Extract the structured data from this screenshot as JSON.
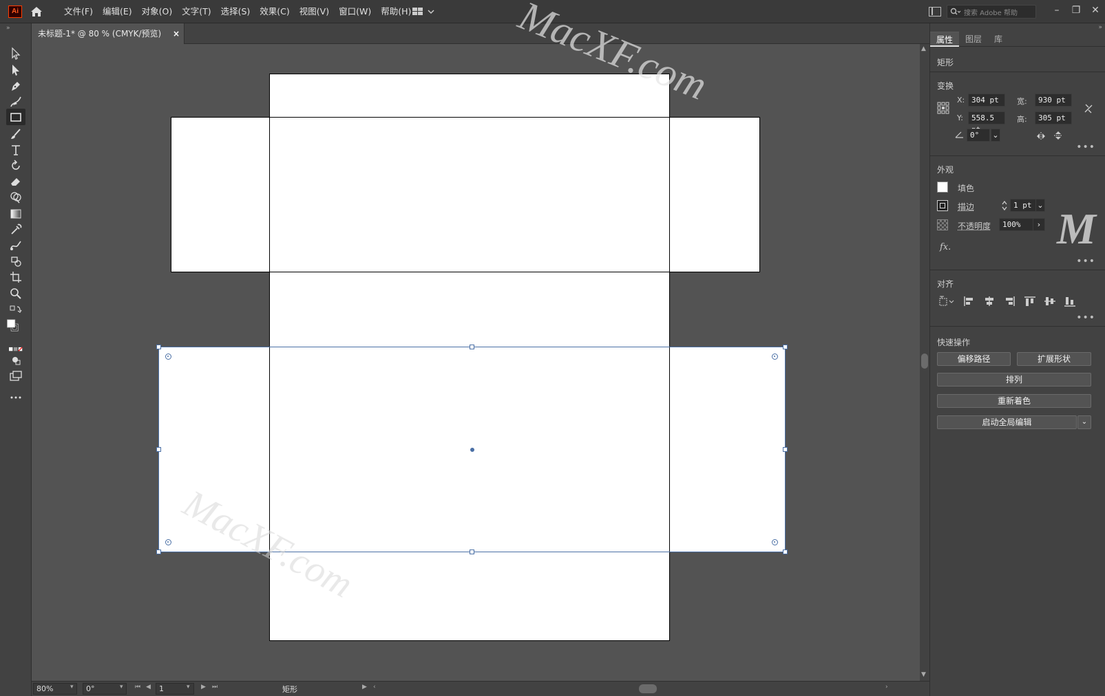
{
  "app": {
    "logo": "Ai",
    "menu": [
      "文件(F)",
      "编辑(E)",
      "对象(O)",
      "文字(T)",
      "选择(S)",
      "效果(C)",
      "视图(V)",
      "窗口(W)",
      "帮助(H)"
    ],
    "search_placeholder": "搜索 Adobe 帮助",
    "window_buttons": [
      "–",
      "❐",
      "✕"
    ]
  },
  "document": {
    "tab_title": "未标题-1* @ 80 % (CMYK/预览)",
    "close_label": "×"
  },
  "watermarks": [
    "MacXF.com",
    "MacXF.com",
    "M"
  ],
  "status": {
    "zoom": "80%",
    "rotation": "0°",
    "artboard_num": "1",
    "selection_tool": "矩形"
  },
  "properties_panel": {
    "tabs": [
      "属性",
      "图层",
      "库"
    ],
    "object_type": "矩形",
    "transform": {
      "title": "变换",
      "x_label": "X:",
      "x_value": "304 pt",
      "y_label": "Y:",
      "y_value": "558.5 pt",
      "w_label": "宽:",
      "w_value": "930 pt",
      "h_label": "高:",
      "h_value": "305 pt",
      "angle_value": "0°"
    },
    "appearance": {
      "title": "外观",
      "fill_label": "填色",
      "stroke_label": "描边",
      "stroke_value": "1 pt",
      "opacity_label": "不透明度",
      "opacity_value": "100%",
      "fx_label": "fx."
    },
    "align": {
      "title": "对齐"
    },
    "quick_actions": {
      "title": "快速操作",
      "offset_path": "偏移路径",
      "expand_shape": "扩展形状",
      "arrange": "排列",
      "recolor": "重新着色",
      "global_edit": "启动全局编辑"
    }
  },
  "colors": {
    "ui_bg": "#535353",
    "panel_bg": "#424242",
    "menubar_bg": "#3a3a3a",
    "selection": "#4a6fa5",
    "artboard": "#ffffff"
  }
}
